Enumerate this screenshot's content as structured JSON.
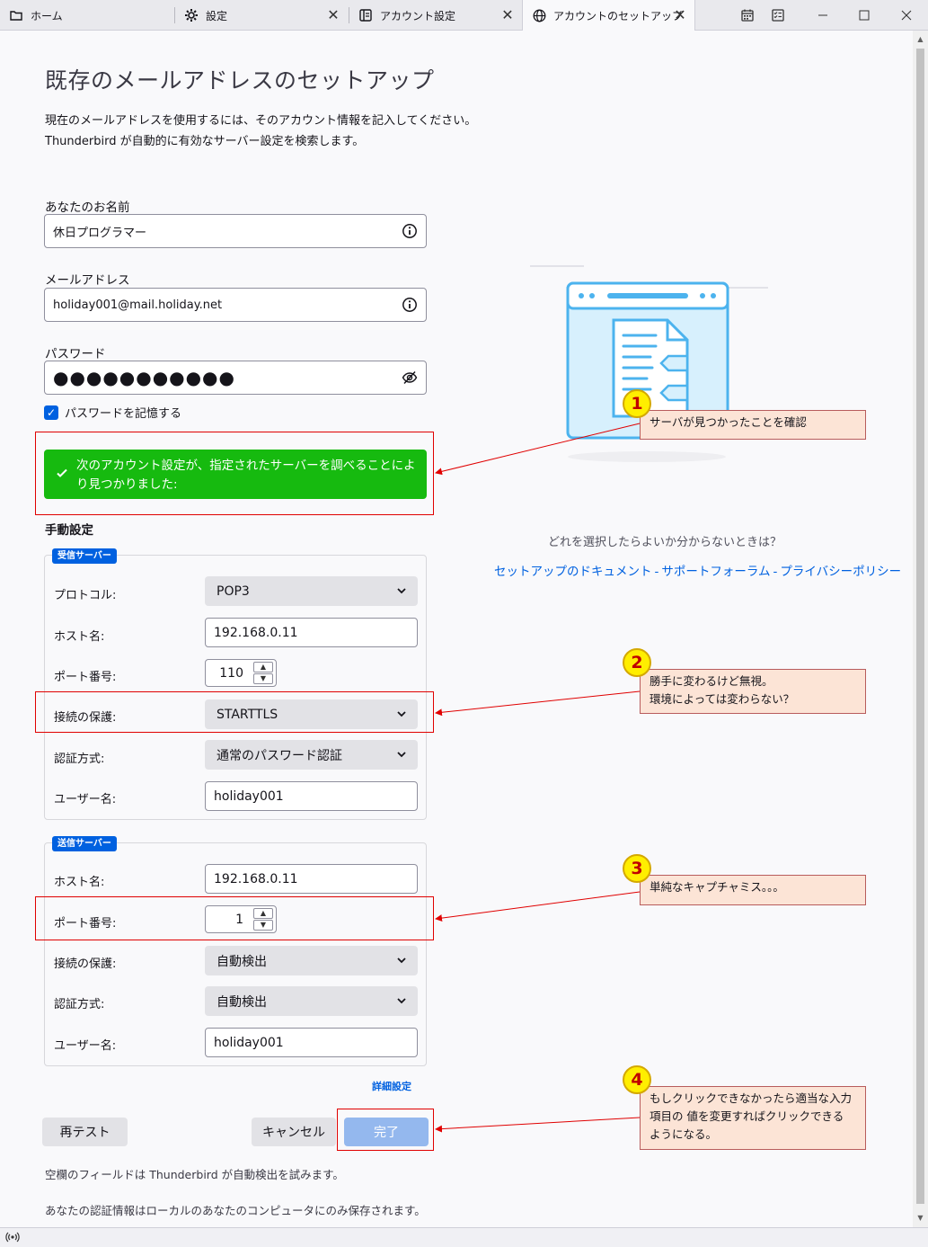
{
  "tabs": [
    {
      "label": "ホーム",
      "icon": "folder-icon"
    },
    {
      "label": "設定",
      "icon": "gear-icon"
    },
    {
      "label": "アカウント設定",
      "icon": "account-settings-icon"
    },
    {
      "label": "アカウントのセットアップ",
      "icon": "globe-icon"
    }
  ],
  "header": {
    "title": "既存のメールアドレスのセットアップ",
    "intro_line1": "現在のメールアドレスを使用するには、そのアカウント情報を記入してください。",
    "intro_line2": "Thunderbird が自動的に有効なサーバー設定を検索します。"
  },
  "form": {
    "name_label": "あなたのお名前",
    "name_value": "休日プログラマー",
    "email_label": "メールアドレス",
    "email_value": "holiday001@mail.holiday.net",
    "password_label": "パスワード",
    "password_value": "●●●●●●●●●●●",
    "remember_label": "パスワードを記憶する",
    "remember_checked": true,
    "success_message": "次のアカウント設定が、指定されたサーバーを調べることにより見つかりました:"
  },
  "manual": {
    "heading": "手動設定",
    "incoming": {
      "legend": "受信サーバー",
      "protocol_label": "プロトコル:",
      "protocol_value": "POP3",
      "host_label": "ホスト名:",
      "host_value": "192.168.0.11",
      "port_label": "ポート番号:",
      "port_value": "110",
      "security_label": "接続の保護:",
      "security_value": "STARTTLS",
      "auth_label": "認証方式:",
      "auth_value": "通常のパスワード認証",
      "user_label": "ユーザー名:",
      "user_value": "holiday001"
    },
    "outgoing": {
      "legend": "送信サーバー",
      "host_label": "ホスト名:",
      "host_value": "192.168.0.11",
      "port_label": "ポート番号:",
      "port_value": "1",
      "security_label": "接続の保護:",
      "security_value": "自動検出",
      "auth_label": "認証方式:",
      "auth_value": "自動検出",
      "user_label": "ユーザー名:",
      "user_value": "holiday001"
    },
    "advanced_link": "詳細設定"
  },
  "buttons": {
    "retest": "再テスト",
    "cancel": "キャンセル",
    "done": "完了"
  },
  "notes": {
    "autodetect": "空欄のフィールドは Thunderbird が自動検出を試みます。",
    "local_storage": "あなたの認証情報はローカルのあなたのコンピュータにのみ保存されます。"
  },
  "help": {
    "question": "どれを選択したらよいか分からないときは？",
    "link_docs": "セットアップのドキュメント",
    "link_forum": "サポートフォーラム",
    "link_privacy": "プライバシーポリシー",
    "separator": "-"
  },
  "annotations": [
    {
      "number": "1",
      "text": "サーバが見つかったことを確認"
    },
    {
      "number": "2",
      "line1": "勝手に変わるけど無視。",
      "line2": "環境によっては変わらない？"
    },
    {
      "number": "3",
      "text": "単純なキャプチャミス。。。"
    },
    {
      "number": "4",
      "line1": "もしクリックできなかったら適当な入力",
      "line2": "項目の 値を変更すればクリックできる",
      "line3": "ようになる。"
    }
  ],
  "colors": {
    "accent": "#0061e0",
    "success": "#16ba0f",
    "annotation_red": "#e00000",
    "callout_bg": "#fce4d6",
    "badge_yellow": "#ffee00"
  }
}
